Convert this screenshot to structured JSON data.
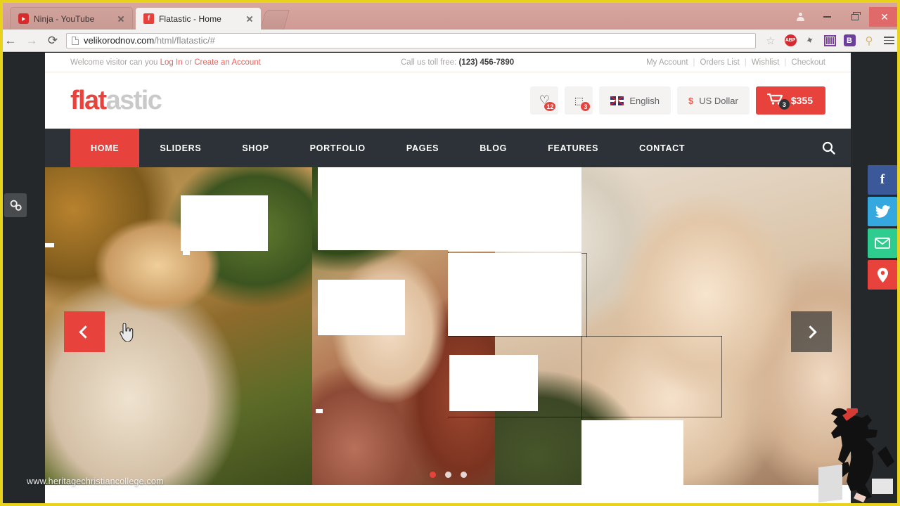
{
  "browser": {
    "tabs": [
      {
        "title": "Ninja - YouTube",
        "favicon": "youtube-icon",
        "active": false
      },
      {
        "title": "Flatastic - Home",
        "favicon": "flatastic-icon",
        "active": true
      }
    ],
    "url": {
      "host": "velikorodnov.com",
      "path": "/html/flatastic/#"
    },
    "nav": {
      "back": "←",
      "forward": "→",
      "reload": "⟳"
    },
    "bookmark_star": "☆",
    "extensions": [
      {
        "name": "adblock-plus-icon",
        "label": "ABP"
      },
      {
        "name": "magic-wand-icon",
        "label": "✦"
      },
      {
        "name": "barcode-icon",
        "label": ""
      },
      {
        "name": "bitwarden-icon",
        "label": "B"
      },
      {
        "name": "signpost-icon",
        "label": "⚲"
      },
      {
        "name": "chrome-menu-icon",
        "label": ""
      }
    ],
    "window_controls": {
      "user": "profile-icon",
      "minimize": "–",
      "maximize": "❐",
      "close": "✕"
    }
  },
  "site": {
    "topbar": {
      "welcome_prefix": "Welcome visitor can you",
      "login_label": "Log In",
      "or_label": "or",
      "create_account_label": "Create an Account",
      "call_label": "Call us toll free:",
      "phone": "(123) 456-7890",
      "links": [
        "My Account",
        "Orders List",
        "Wishlist",
        "Checkout"
      ],
      "separator": "|"
    },
    "header": {
      "logo_part1": "flat",
      "logo_part2": "astic",
      "wishlist": {
        "icon": "heart-icon",
        "glyph": "♡",
        "count": "12"
      },
      "compare": {
        "icon": "compare-icon",
        "glyph": "⬚",
        "count": "3"
      },
      "language": {
        "label": "English",
        "flag": "uk-flag-icon"
      },
      "currency": {
        "sign": "$",
        "label": "US Dollar"
      },
      "cart": {
        "glyph": "🛒",
        "count": "3",
        "total": "$355"
      }
    },
    "nav": {
      "items": [
        {
          "label": "HOME",
          "active": true
        },
        {
          "label": "SLIDERS",
          "active": false
        },
        {
          "label": "SHOP",
          "active": false
        },
        {
          "label": "PORTFOLIO",
          "active": false
        },
        {
          "label": "PAGES",
          "active": false
        },
        {
          "label": "BLOG",
          "active": false
        },
        {
          "label": "FEATURES",
          "active": false
        },
        {
          "label": "CONTACT",
          "active": false
        }
      ],
      "search_glyph": "🔍"
    },
    "slider": {
      "prev_label": "‹",
      "next_label": "›",
      "dots": [
        {
          "active": true
        },
        {
          "active": false
        },
        {
          "active": false
        }
      ]
    },
    "settings_widget": {
      "icon": "gear-settings-icon",
      "glyph": "⚙"
    },
    "social_rail": [
      {
        "name": "facebook-icon",
        "glyph": "f",
        "color": "#3b5998"
      },
      {
        "name": "twitter-icon",
        "glyph": "🐦",
        "color": "#35a8e0"
      },
      {
        "name": "email-icon",
        "glyph": "✉",
        "color": "#2ecc8f"
      },
      {
        "name": "location-pin-icon",
        "glyph": "📍",
        "color": "#e8423d"
      }
    ]
  },
  "overlay": {
    "watermark": "www.heritagechristiancollege.com",
    "mascot": "ninja-mascot-icon"
  },
  "colors": {
    "brand_red": "#e8423d",
    "nav_dark": "#2d3238",
    "logo_grey": "#c9c9c9",
    "chrome_frame": "#cf9a93",
    "recording_border": "#e8d21c"
  }
}
